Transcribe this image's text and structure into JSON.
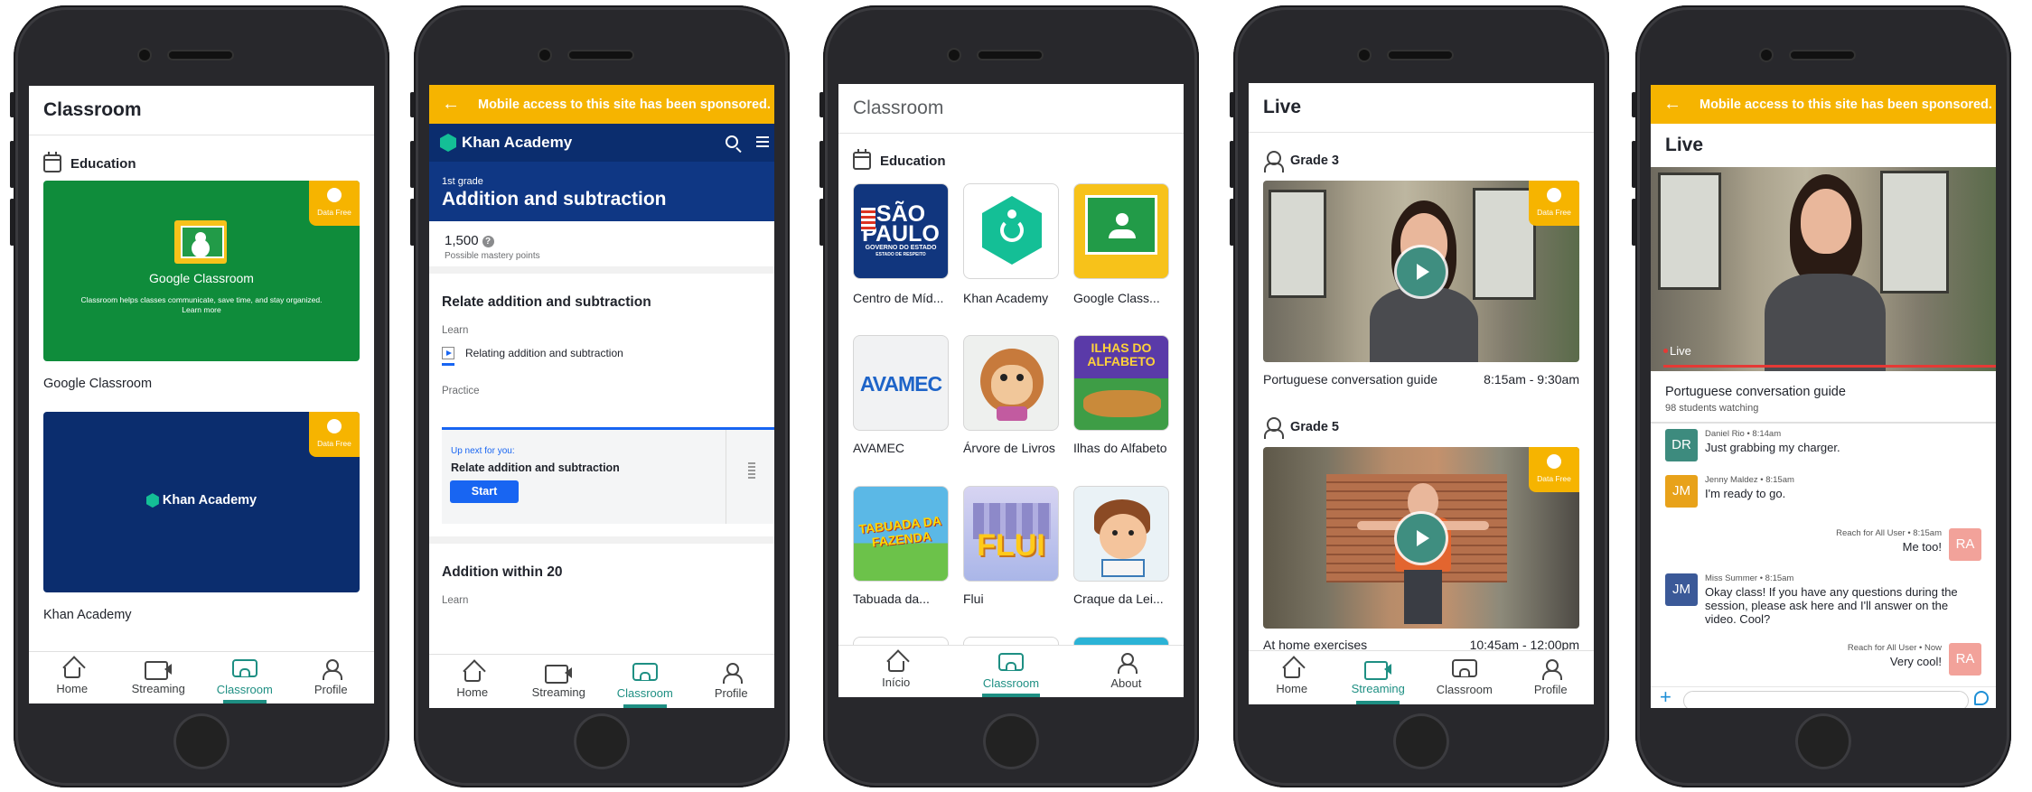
{
  "nav_common": {
    "home": "Home",
    "streaming": "Streaming",
    "classroom": "Classroom",
    "profile": "Profile"
  },
  "screen1": {
    "title": "Classroom",
    "section": "Education",
    "data_free": "Data Free",
    "cards": [
      {
        "name": "Google Classroom",
        "logo_text": "Google Classroom",
        "description": "Classroom helps classes communicate, save time, and stay organized. Learn more",
        "caption": "Google Classroom"
      },
      {
        "name": "Khan Academy",
        "logo_text": "Khan Academy",
        "caption": "Khan Academy"
      }
    ],
    "active_tab": "Classroom"
  },
  "screen2": {
    "sponsor_text": "Mobile access to this site has been sponsored.",
    "header_logo": "Khan Academy",
    "grade": "1st grade",
    "course_title": "Addition and subtraction",
    "mastery_value": "1,500",
    "mastery_label": "Possible mastery points",
    "unit1_title": "Relate addition and subtraction",
    "learn_label": "Learn",
    "lesson": "Relating addition and subtraction",
    "practice_label": "Practice",
    "upnext_label": "Up next for you:",
    "upnext_title": "Relate addition and subtraction",
    "start_label": "Start",
    "unit2_title": "Addition within 20",
    "learn_label2": "Learn",
    "active_tab": "Classroom"
  },
  "screen3": {
    "title": "Classroom",
    "section": "Education",
    "apps": [
      {
        "caption": "Centro de Míd...",
        "logo_lines": [
          "SÃO",
          "PAULO"
        ],
        "logo_sub": "GOVERNO DO ESTADO",
        "logo_sub2": "ESTADO DE RESPEITO"
      },
      {
        "caption": "Khan Academy"
      },
      {
        "caption": "Google Class..."
      },
      {
        "caption": "AVAMEC",
        "logo": "AVAMEC"
      },
      {
        "caption": "Árvore de Livros"
      },
      {
        "caption": "Ilhas do Alfabeto",
        "logo": "ILHAS DO ALFABETO"
      },
      {
        "caption": "Tabuada da...",
        "logo": "TABUADA DA FAZENDA"
      },
      {
        "caption": "Flui",
        "logo": "FLUI"
      },
      {
        "caption": "Craque da Lei..."
      }
    ],
    "nav": {
      "home": "Início",
      "classroom": "Classroom",
      "about": "About"
    },
    "active_tab": "Classroom"
  },
  "screen4": {
    "title": "Live",
    "data_free": "Data Free",
    "groups": [
      {
        "grade": "Grade 3",
        "video_title": "Portuguese conversation guide",
        "time": "8:15am - 9:30am"
      },
      {
        "grade": "Grade 5",
        "video_title": "At home exercises",
        "time": "10:45am - 12:00pm"
      }
    ],
    "active_tab": "Streaming"
  },
  "screen5": {
    "sponsor_text": "Mobile access to this site has been sponsored.",
    "title": "Live",
    "live_badge": "Live",
    "video_title": "Portuguese conversation guide",
    "watching": "98 students watching",
    "messages": [
      {
        "initials": "DR",
        "meta": "Daniel Rio • 8:14am",
        "text": "Just grabbing my charger.",
        "side": "left",
        "color": "#3d8b7e"
      },
      {
        "initials": "JM",
        "meta": "Jenny Maldez • 8:15am",
        "text": "I'm ready to go.",
        "side": "left",
        "color": "#e8a21a"
      },
      {
        "initials": "RA",
        "meta": "Reach for All User • 8:15am",
        "text": "Me too!",
        "side": "right",
        "color": "#f2a29a"
      },
      {
        "initials": "JM",
        "meta": "Miss Summer • 8:15am",
        "text": "Okay class! If you have any questions during the session, please ask here and I'll answer on the video. Cool?",
        "side": "left",
        "color": "#3b5998"
      },
      {
        "initials": "RA",
        "meta": "Reach for All User • Now",
        "text": "Very cool!",
        "side": "right",
        "color": "#f2a29a"
      }
    ],
    "composer_plus": "+"
  },
  "colors": {
    "accent_teal": "#1e8f83",
    "sponsor_yellow": "#f6b400",
    "khan_navy": "#0b2d6e",
    "google_green": "#0f8c3b"
  }
}
